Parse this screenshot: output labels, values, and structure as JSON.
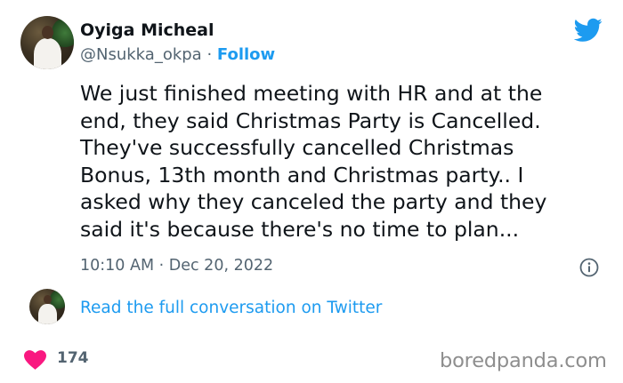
{
  "tweet": {
    "author_name": "Oyiga Micheal",
    "handle": "@Nsukka_okpa",
    "separator": " · ",
    "follow_label": "Follow",
    "text": "We just finished meeting with HR and at the\nend, they said Christmas Party is Cancelled.\nThey've successfully cancelled Christmas\nBonus, 13th month and Christmas party.. I\nasked why they canceled the party and they\nsaid it's because there's no time to plan...",
    "timestamp": "10:10 AM · Dec 20, 2022",
    "read_full_label": "Read the full conversation on Twitter",
    "like_count": "174"
  },
  "branding": {
    "platform_icon": "twitter-bird-icon",
    "watermark": "boredpanda.com"
  },
  "colors": {
    "accent": "#1d9bf0",
    "text": "#0f1419",
    "muted": "#536471",
    "heart": "#f91880"
  }
}
